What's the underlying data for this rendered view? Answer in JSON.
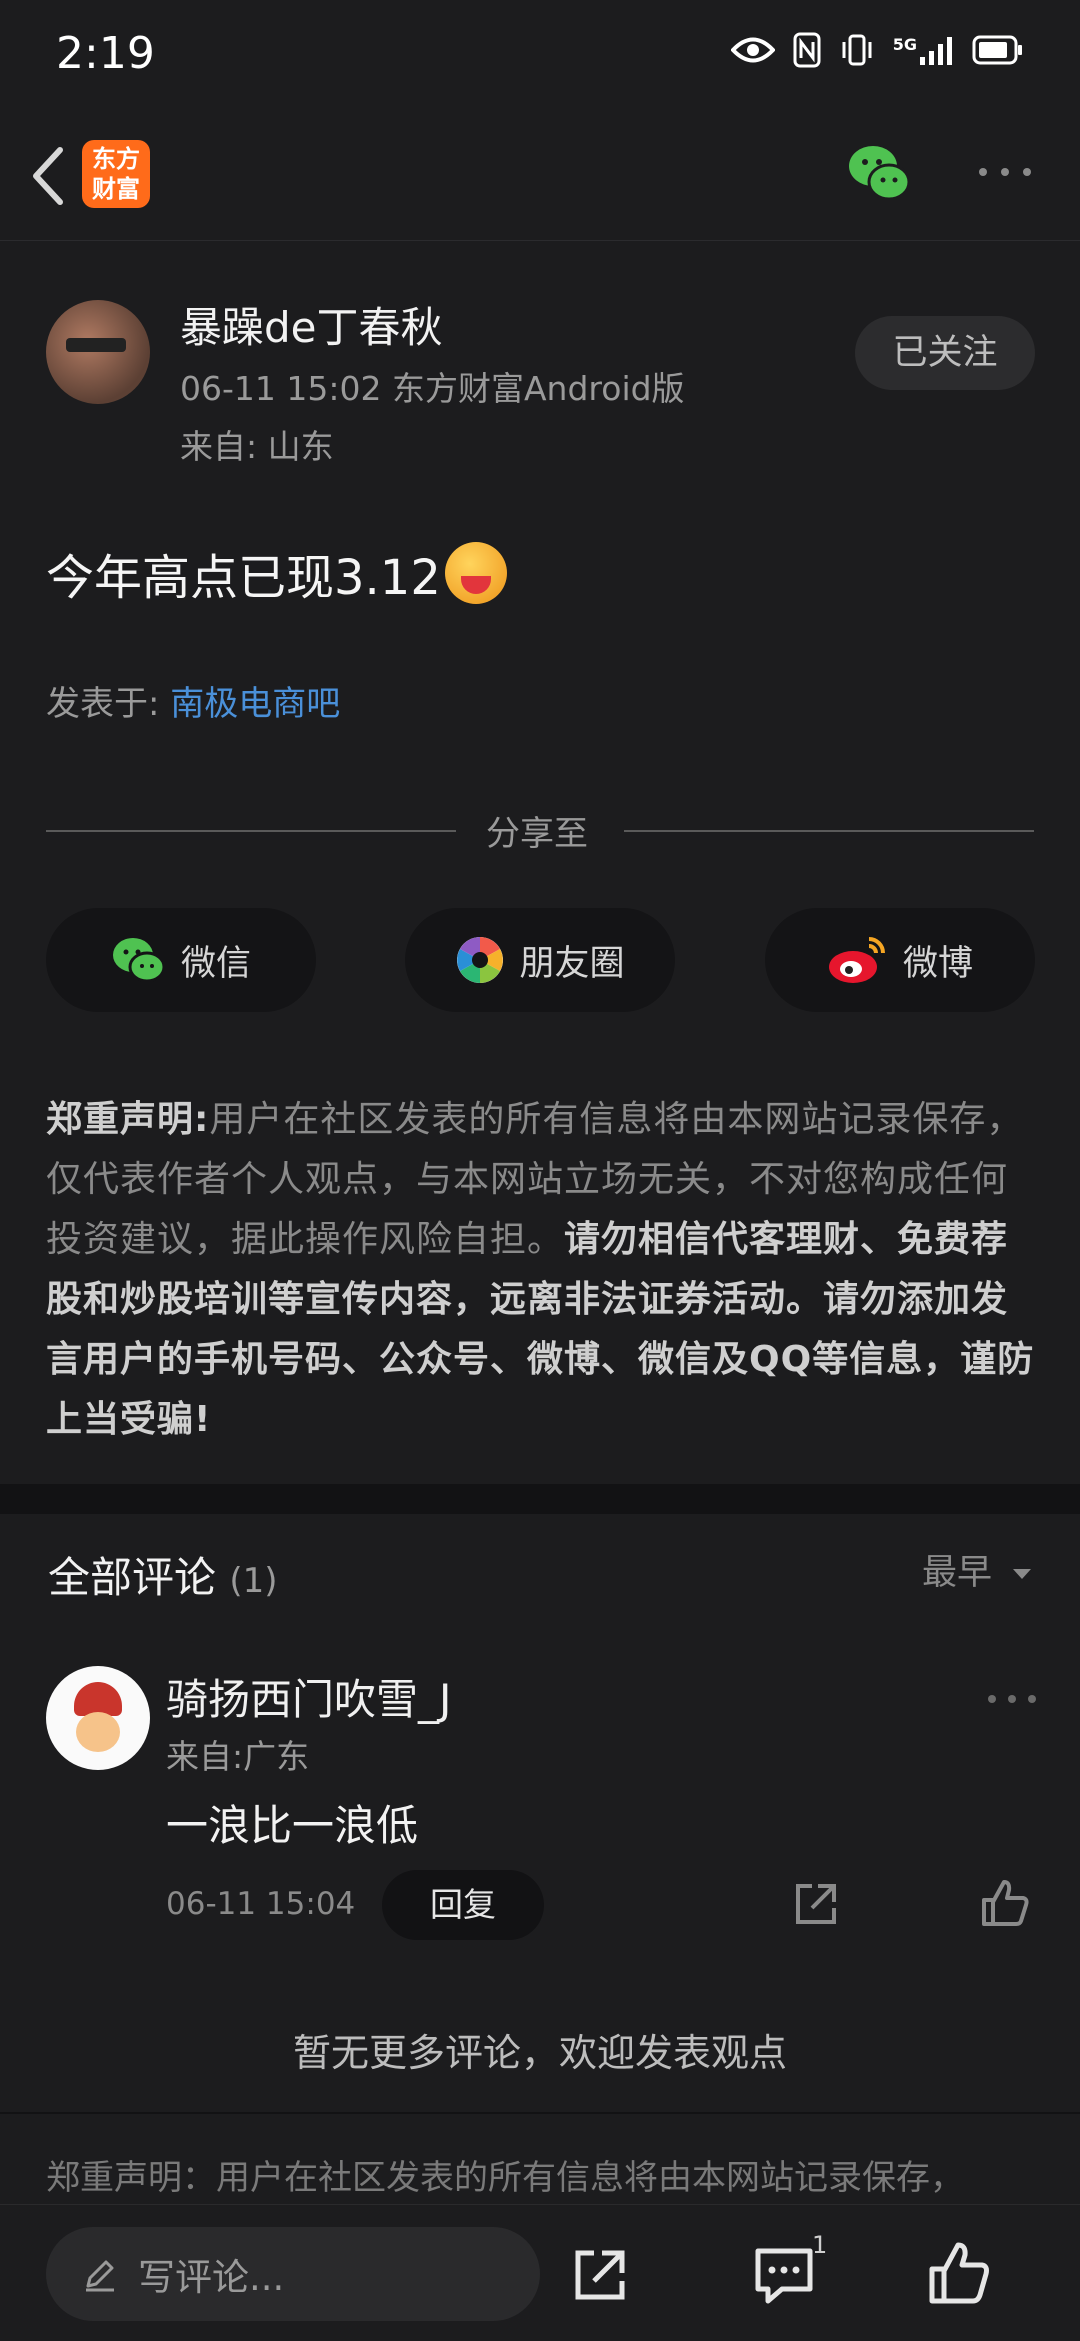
{
  "status_bar": {
    "time": "2:19",
    "network": "5G"
  },
  "topbar": {
    "logo_text_line1": "东方",
    "logo_text_line2": "财富"
  },
  "post": {
    "author": "暴躁de丁春秋",
    "meta": "06-11 15:02 东方财富Android版",
    "location": "来自: 山东",
    "follow_label": "已关注",
    "content": "今年高点已现3.12",
    "posted_in_label": "发表于: ",
    "posted_in_link": "南极电商吧"
  },
  "share": {
    "label": "分享至",
    "wechat": "微信",
    "moments": "朋友圈",
    "weibo": "微博"
  },
  "disclaimer": {
    "title": "郑重声明:",
    "body": "用户在社区发表的所有信息将由本网站记录保存，仅代表作者个人观点，与本网站立场无关，不对您构成任何投资建议，据此操作风险自担。",
    "bold": "请勿相信代客理财、免费荐股和炒股培训等宣传内容，远离非法证券活动。请勿添加发言用户的手机号码、公众号、微博、微信及QQ等信息，谨防上当受骗!"
  },
  "comments": {
    "title": "全部评论",
    "count": "(1)",
    "sort_label": "最早",
    "items": [
      {
        "name": "骑扬西门吹雪_J",
        "location": "来自:广东",
        "text": "一浪比一浪低",
        "time": "06-11 15:04",
        "reply_label": "回复"
      }
    ],
    "no_more": "暂无更多评论，欢迎发表观点"
  },
  "footer_disclaimer": "郑重声明：用户在社区发表的所有信息将由本网站记录保存，",
  "bottom_bar": {
    "input_placeholder": "写评论...",
    "comment_badge": "1"
  },
  "colors": {
    "background": "#1c1c1e",
    "link": "#4a90d9",
    "wechat_green": "#4fc251",
    "logo_orange": "#ff6b1a"
  }
}
